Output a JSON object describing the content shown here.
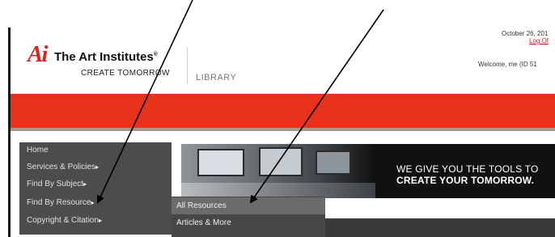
{
  "header": {
    "logo_mark": "Ai",
    "logo_name": "The Art Institutes",
    "logo_registered": "®",
    "logo_tagline": "CREATE TOMORROW",
    "section_label": "LIBRARY",
    "date": "October 26, 201",
    "logoff_label": "Log Of",
    "welcome": "Welcome, me (ID 51"
  },
  "nav": {
    "items": [
      {
        "label": "Home",
        "arrow": ""
      },
      {
        "label": "Services & Policies",
        "arrow": "▸"
      },
      {
        "label": "Find By Subject",
        "arrow": "▸"
      },
      {
        "label": "Find By Resource",
        "arrow": "▸"
      },
      {
        "label": "Copyright & Citation",
        "arrow": "▸"
      }
    ]
  },
  "hero": {
    "line1": "WE GIVE YOU THE TOOLS TO",
    "line2": "CREATE YOUR TOMORROW."
  },
  "submenu": {
    "items": [
      {
        "label": "All Resources",
        "active": true
      },
      {
        "label": "Articles & More",
        "active": false
      }
    ]
  },
  "colors": {
    "brand_red": "#e8321c",
    "nav_bg": "#4c4c4c",
    "submenu_bg": "#474747",
    "annotation": "#000000"
  }
}
